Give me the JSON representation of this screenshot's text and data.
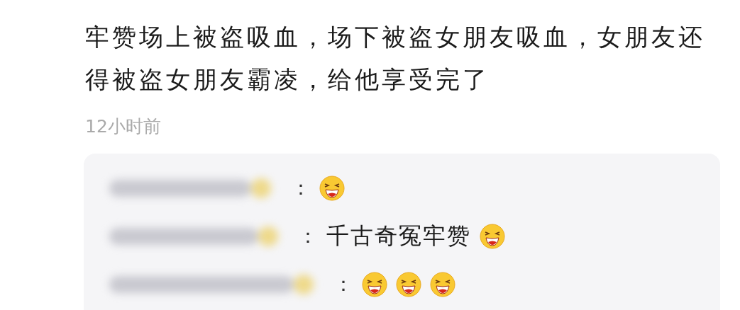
{
  "comment": {
    "text": "牢赞场上被盗吸血，场下被盗女朋友吸血，女朋友还得被盗女朋友霸凌，给他享受完了",
    "time": "12小时前"
  },
  "replies": [
    {
      "colon": "：",
      "emojis": [
        {
          "kind": "grin"
        }
      ]
    },
    {
      "colon": "：",
      "text": "千古奇冤牢赞",
      "emojis": [
        {
          "kind": "grin"
        }
      ]
    },
    {
      "colon": "：",
      "emojis": [
        {
          "kind": "grin"
        },
        {
          "kind": "grin"
        },
        {
          "kind": "grin"
        }
      ]
    }
  ]
}
